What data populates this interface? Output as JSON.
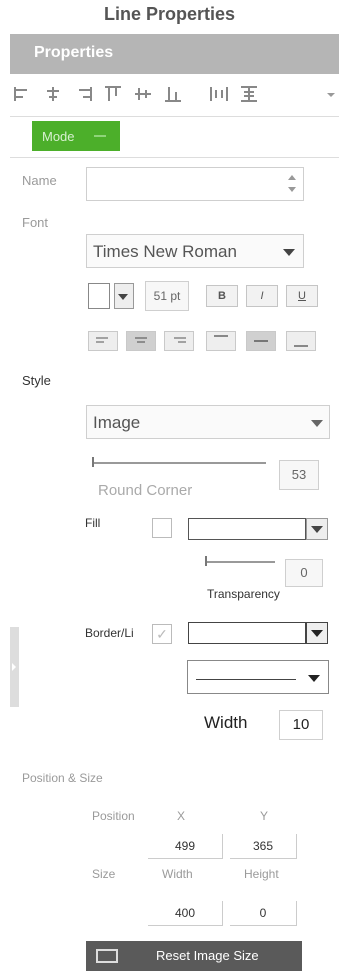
{
  "page_title": "Line Properties",
  "panel": {
    "title": "Properties"
  },
  "toolbar": {
    "icons": [
      "align-left-icon",
      "align-center-icon",
      "align-right-icon",
      "align-top-icon",
      "align-middle-icon",
      "align-bottom-icon",
      "distribute-horizontal-icon",
      "distribute-vertical-icon",
      "overflow-dropdown-icon"
    ]
  },
  "mode": {
    "label": "Mode",
    "accent": "#4caf2a"
  },
  "name": {
    "label": "Name",
    "value": ""
  },
  "font": {
    "label": "Font",
    "family": "Times New Roman",
    "size": "51 pt",
    "bold": "B",
    "italic": "I",
    "underline": "U",
    "alignments": [
      "text-align-left-icon",
      "text-align-center-icon",
      "text-align-right-icon",
      "valign-top-icon",
      "valign-middle-icon",
      "valign-bottom-icon"
    ]
  },
  "style": {
    "label": "Style",
    "type": "Image",
    "round_corner_label": "Round Corner",
    "round_corner_value": "53",
    "fill_label": "Fill",
    "transparency_label": "Transparency",
    "transparency_value": "0",
    "border_label": "Border/Li",
    "width_label": "Width",
    "width_value": "10"
  },
  "position_size": {
    "label": "Position & Size",
    "position_label": "Position",
    "x_label": "X",
    "y_label": "Y",
    "x": "499",
    "y": "365",
    "size_label": "Size",
    "width_label": "Width",
    "height_label": "Height",
    "width": "400",
    "height": "0",
    "reset_label": "Reset Image Size"
  }
}
